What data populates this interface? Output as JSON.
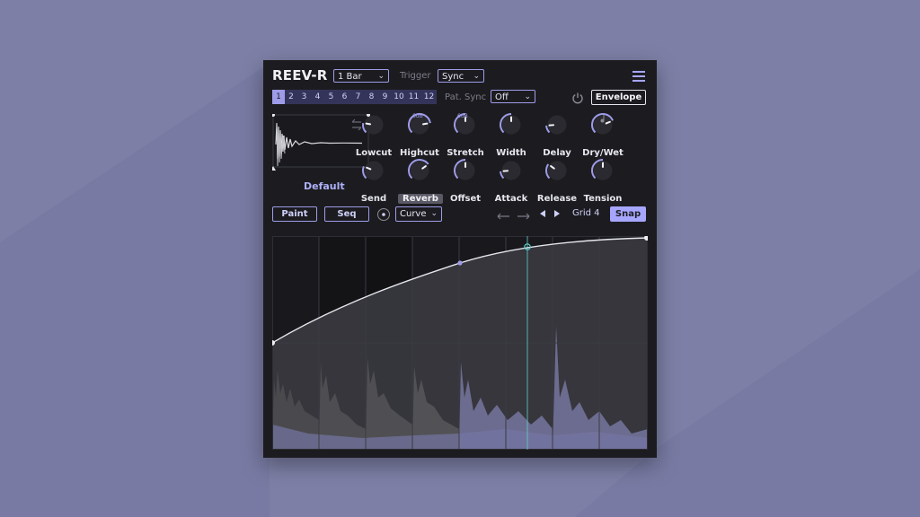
{
  "plugin": {
    "title": "REEV-R",
    "length_select": "1 Bar",
    "trigger_label": "Trigger",
    "trigger_select": "Sync",
    "pattern_label": "Pat. Sync",
    "pattern_select": "Off",
    "envelope_button": "Envelope",
    "patterns": [
      "1",
      "2",
      "3",
      "4",
      "5",
      "6",
      "7",
      "8",
      "9",
      "10",
      "11",
      "12"
    ],
    "active_pattern": "1",
    "preset_name": "Default",
    "knob_rows": [
      [
        {
          "label": "Lowcut",
          "value": 0.2
        },
        {
          "label": "Highcut",
          "value": 0.8
        },
        {
          "label": "Stretch",
          "value": 0.5
        },
        {
          "label": "Width",
          "value": 0.5
        },
        {
          "label": "Delay",
          "value": 0.15
        },
        {
          "label": "Dry/Wet",
          "value": 0.75
        }
      ],
      [
        {
          "label": "Send",
          "value": 0.25
        },
        {
          "label": "Reverb",
          "value": 0.7
        },
        {
          "label": "Offset",
          "value": 0.5
        },
        {
          "label": "Attack",
          "value": 0.15
        },
        {
          "label": "Release",
          "value": 0.3
        },
        {
          "label": "Tension",
          "value": 0.5
        }
      ]
    ],
    "db_marks": [
      "6dB",
      "6dB"
    ],
    "toolbar": {
      "paint_button": "Paint",
      "seq_button": "Seq",
      "curve_select": "Curve",
      "grid_label": "Grid 4",
      "snap_button": "Snap"
    },
    "colors": {
      "accent": "#9e9ce8",
      "panel": "#1c1c20",
      "background": "#7d7fa6",
      "snap": "#a6a6ff",
      "marker": "#5fd0c8"
    }
  }
}
